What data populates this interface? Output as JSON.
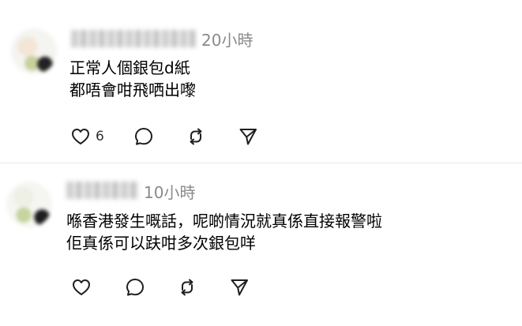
{
  "comments": [
    {
      "time": "20小時",
      "lines": [
        "正常人個銀包d紙",
        "都唔會咁飛哂出嚟"
      ],
      "like_count": "6"
    },
    {
      "time": "10小時",
      "lines": [
        "喺香港發生嘅話，呢啲情況就真係直接報警啦",
        "佢真係可以趺咁多次銀包咩"
      ],
      "like_count": ""
    }
  ],
  "icons": {
    "like": "heart-icon",
    "reply": "speech-bubble-icon",
    "repost": "repost-arrows-icon",
    "share": "send-icon"
  },
  "colors": {
    "timestamp": "#8a8a8a",
    "icon": "#1f1f1f",
    "divider": "#e6e6e6"
  }
}
